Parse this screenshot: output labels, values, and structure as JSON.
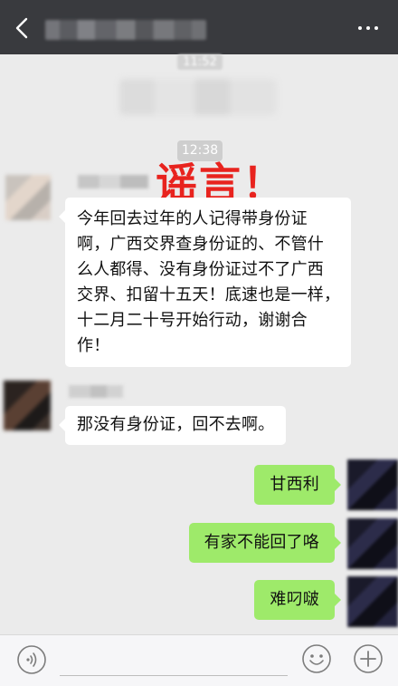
{
  "header": {
    "back_icon": "chevron-left-icon",
    "more_icon": "more-dots-icon"
  },
  "timestamps": {
    "first": "11:52",
    "second": "12:38"
  },
  "stamp": {
    "text": "谣言！",
    "color": "#e8231e"
  },
  "messages": [
    {
      "side": "left",
      "lines": [
        "今年回去过年的人记得带身份证",
        "啊，广西交界查身份证的、不管什",
        "么人都得、没有身份证过不了广西",
        "交界、扣留十五天！底速也是一样，",
        "十二月二十号开始行动，谢谢合",
        "作！"
      ]
    },
    {
      "side": "left",
      "lines": [
        "那没有身份证，回不去啊。"
      ]
    },
    {
      "side": "right",
      "lines": [
        "甘西利"
      ]
    },
    {
      "side": "right",
      "lines": [
        "有家不能回了咯"
      ]
    },
    {
      "side": "right",
      "lines": [
        "难叼啵"
      ]
    }
  ],
  "colors": {
    "header_bg": "#393a3e",
    "chat_bg": "#ebebeb",
    "bubble_left": "#ffffff",
    "bubble_right": "#9eea6a",
    "timestamp_bg": "#cecece"
  },
  "input_bar": {
    "voice_icon": "voice-icon",
    "emoji_icon": "emoji-icon",
    "plus_icon": "plus-icon"
  }
}
